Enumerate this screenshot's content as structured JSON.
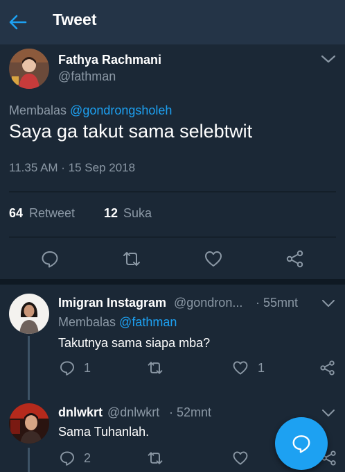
{
  "colors": {
    "background": "#1b2836",
    "header": "#243447",
    "accent": "#1da1f2",
    "muted": "#8b98a5"
  },
  "header": {
    "title": "Tweet",
    "back_icon": "arrow-left-icon"
  },
  "main_tweet": {
    "name": "Fathya Rachmani",
    "handle": "@fathman",
    "reply_prefix": "Membalas",
    "reply_to": "@gondrongsholeh",
    "text": "Saya ga takut sama selebtwit",
    "timestamp": "11.35 AM · 15 Sep 2018",
    "retweet_count": "64",
    "retweet_label": "Retweet",
    "like_count": "12",
    "like_label": "Suka"
  },
  "replies": [
    {
      "name": "Imigran Instagram",
      "handle": "@gondron...",
      "time": "· 55mnt",
      "reply_prefix": "Membalas",
      "reply_to": "@fathman",
      "text": "Takutnya sama siapa mba?",
      "reply_count": "1",
      "like_count": "1"
    },
    {
      "name": "dnlwkrt",
      "handle": "@dnlwkrt",
      "time": "· 52mnt",
      "text": "Sama Tuhanlah.",
      "reply_count": "2"
    }
  ]
}
